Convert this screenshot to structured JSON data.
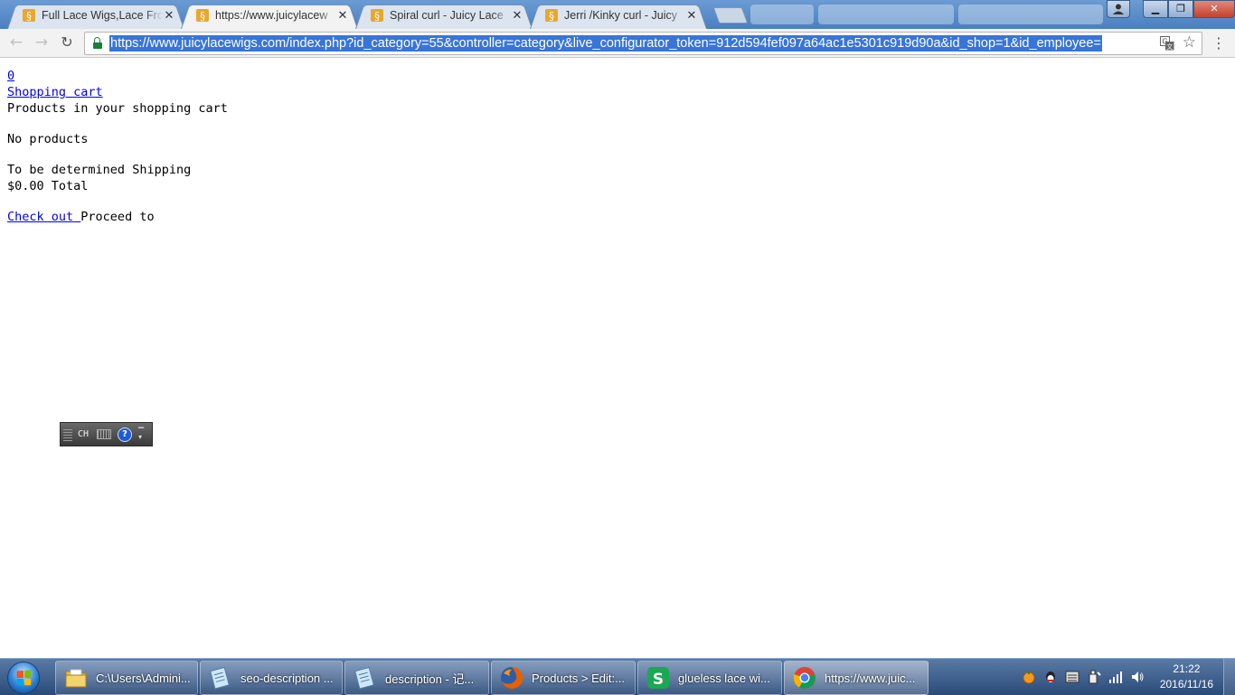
{
  "browser": {
    "tabs": [
      {
        "title": "Full Lace Wigs,Lace Fro",
        "active": false
      },
      {
        "title": "https://www.juicylacew",
        "active": true
      },
      {
        "title": "Spiral curl - Juicy Lace",
        "active": false
      },
      {
        "title": "Jerri /Kinky curl - Juicy",
        "active": false
      }
    ],
    "url": "https://www.juicylacewigs.com/index.php?id_category=55&controller=category&live_configurator_token=912d594fef097a64ac1e5301c919d90a&id_shop=1&id_employee=",
    "window_buttons": {
      "minimize": "▁",
      "restore": "❐",
      "close": "✕"
    }
  },
  "page": {
    "cart_count": "0",
    "cart_link": "Shopping cart",
    "products_heading": "Products in your shopping cart",
    "empty_message": "No products",
    "shipping_value": "To be determined",
    "shipping_label": "Shipping",
    "total_value": "$0.00",
    "total_label": "Total",
    "checkout_link": "Check out",
    "proceed_text": "Proceed to"
  },
  "ime_bar": {
    "language": "CH"
  },
  "taskbar": {
    "items": [
      {
        "label": "C:\\Users\\Admini...",
        "icon": "folder-icon"
      },
      {
        "label": "seo-description ...",
        "icon": "notepad-icon"
      },
      {
        "label": "description - 记...",
        "icon": "notepad-icon"
      },
      {
        "label": "Products > Edit:...",
        "icon": "firefox-icon"
      },
      {
        "label": "glueless lace wi...",
        "icon": "wps-icon"
      },
      {
        "label": "https://www.juic...",
        "icon": "chrome-icon"
      }
    ],
    "clock_time": "21:22",
    "clock_date": "2016/11/16"
  },
  "colors": {
    "link": "#0000ee",
    "url_highlight": "#3875d7",
    "taskbar": "#2a4a78"
  }
}
